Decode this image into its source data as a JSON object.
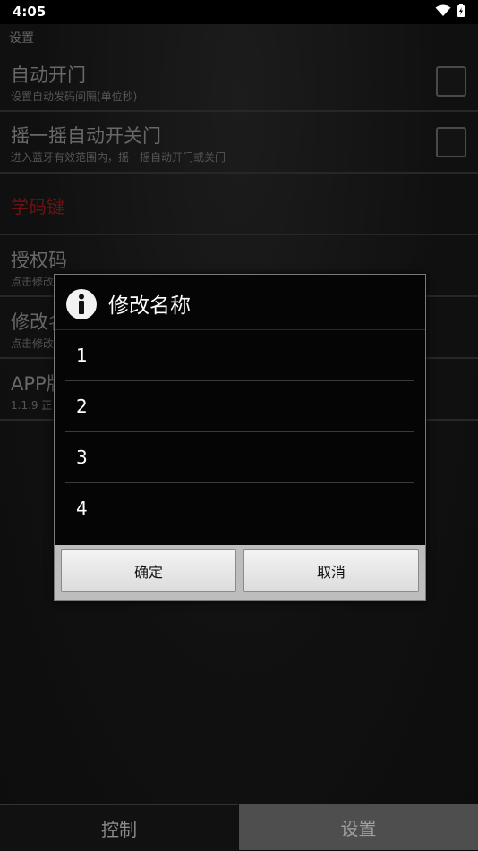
{
  "status_bar": {
    "time": "4:05"
  },
  "screen": {
    "title": "设置",
    "prefs": [
      {
        "title": "自动开门",
        "summary": "设置自动发码间隔(单位秒)"
      },
      {
        "title": "摇一摇自动开关门",
        "summary": "进入蓝牙有效范围内，摇一摇自动开门或关门"
      }
    ],
    "section_header": "学码键",
    "prefs2": [
      {
        "title": "授权码",
        "summary": "点击修改"
      },
      {
        "title": "修改名",
        "summary": "点击修改"
      },
      {
        "title": "APP版",
        "summary": "1.1.9 正"
      }
    ]
  },
  "dialog": {
    "title": "修改名称",
    "items": [
      "1",
      "2",
      "3",
      "4"
    ],
    "ok_label": "确定",
    "cancel_label": "取消"
  },
  "bottom_tabs": {
    "control": "控制",
    "settings": "设置"
  }
}
